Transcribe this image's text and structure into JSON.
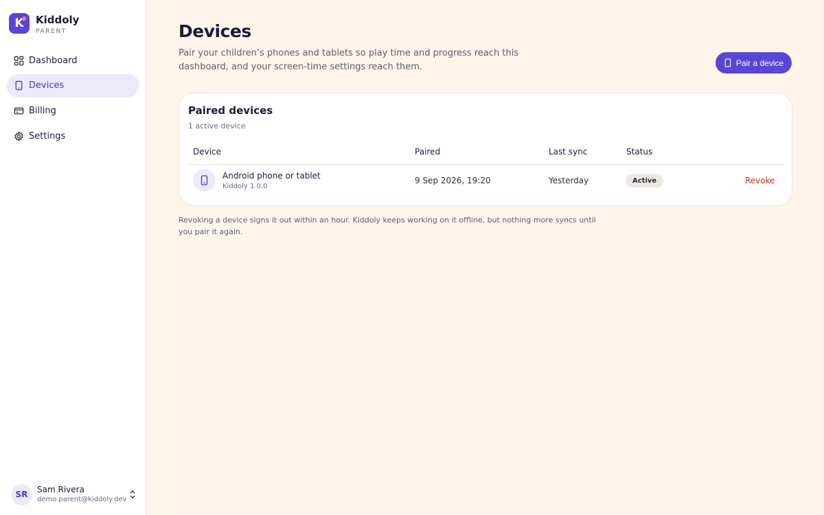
{
  "brand": {
    "logo_letter": "K",
    "name": "Kiddoly",
    "subtitle": "PARENT",
    "accent": "#5b45d6"
  },
  "nav": {
    "items": [
      {
        "label": "Dashboard",
        "icon": "grid-icon"
      },
      {
        "label": "Devices",
        "icon": "phone-icon",
        "active": true
      },
      {
        "label": "Billing",
        "icon": "card-icon"
      },
      {
        "label": "Settings",
        "icon": "gear-icon"
      }
    ]
  },
  "user": {
    "initials": "SR",
    "name": "Sam Rivera",
    "email": "demo.parent@kiddoly.dev"
  },
  "header": {
    "title": "Devices",
    "description": "Pair your children’s phones and tablets so play time and progress reach this dashboard, and your screen-time settings reach them.",
    "pair_button": "Pair a device"
  },
  "card": {
    "title": "Paired devices",
    "subtitle": "1 active device",
    "columns": [
      "Device",
      "Paired",
      "Last sync",
      "Status"
    ],
    "rows": [
      {
        "device": "Android phone or tablet",
        "version": "Kiddoly 1.0.0",
        "paired": "9 Sep 2026, 19:20",
        "last_sync": "Yesterday",
        "status": "Active",
        "action": "Revoke"
      }
    ]
  },
  "note": "Revoking a device signs it out within an hour. Kiddoly keeps working on it offline, but nothing more syncs until you pair it again.",
  "colors": {
    "danger": "#d42a1e",
    "background": "#fdf5ea"
  }
}
